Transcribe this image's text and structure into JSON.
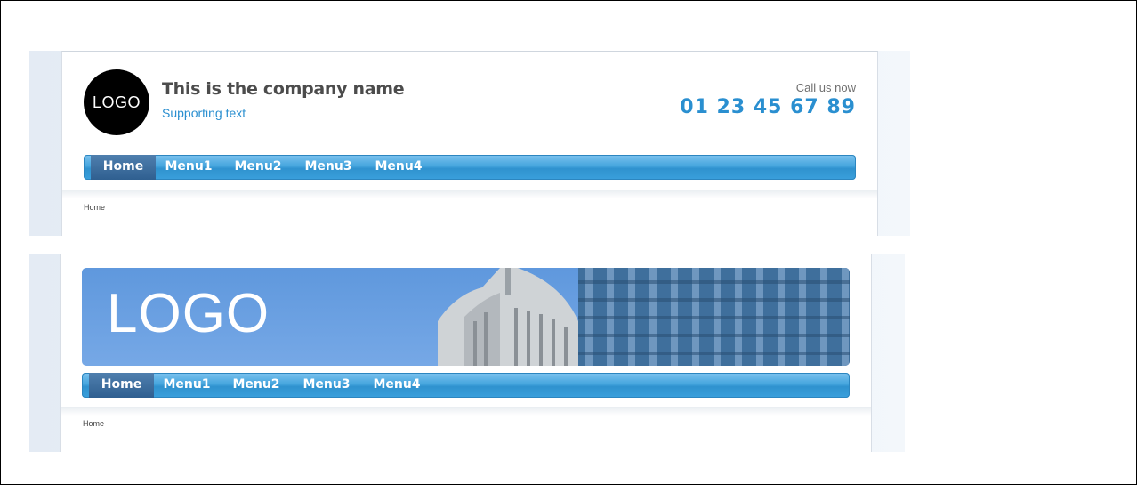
{
  "header_variant_1": {
    "logo_text": "LOGO",
    "company_name": "This is the company name",
    "supporting_text": "Supporting text",
    "call_label": "Call us now",
    "phone": "01 23 45 67 89",
    "nav": [
      "Home",
      "Menu1",
      "Menu2",
      "Menu3",
      "Menu4"
    ],
    "active_nav": "Home",
    "breadcrumb": "Home"
  },
  "header_variant_2": {
    "banner_logo_text": "LOGO",
    "nav": [
      "Home",
      "Menu1",
      "Menu2",
      "Menu3",
      "Menu4"
    ],
    "active_nav": "Home",
    "breadcrumb": "Home"
  },
  "colors": {
    "accent_blue": "#2a8fd0",
    "nav_active": "#2f5f90",
    "banner_sky": "#6a9fe0"
  }
}
